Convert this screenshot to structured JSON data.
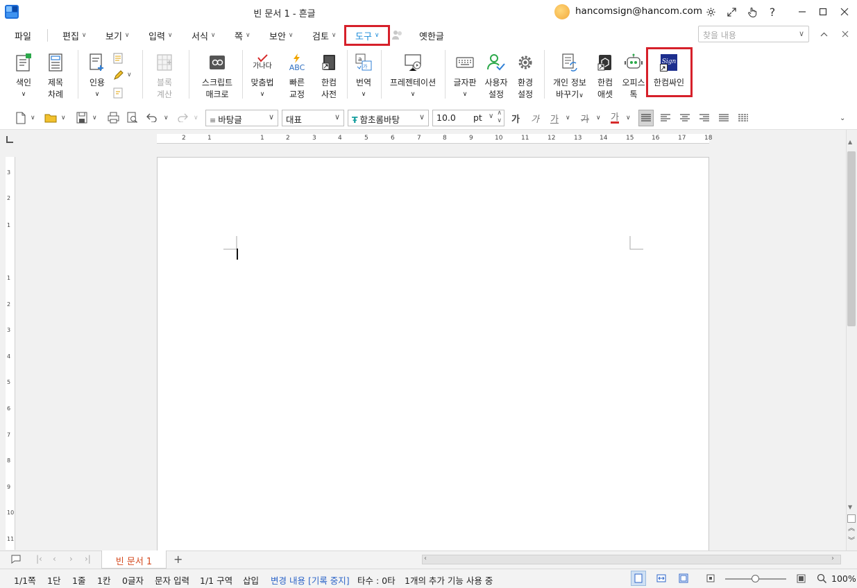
{
  "window": {
    "title": "빈 문서 1 - 흔글",
    "account": "hancomsign@hancom.com"
  },
  "menu": {
    "file": "파일",
    "items": [
      "편집",
      "보기",
      "입력",
      "서식",
      "쪽",
      "보안",
      "검토",
      "도구",
      "옛한글"
    ],
    "search_placeholder": "찾을 내용"
  },
  "ribbon": {
    "index_l1": "색인",
    "toc_l1": "제목",
    "toc_l2": "차례",
    "cite_l1": "인용",
    "block_l1": "블록",
    "block_l2": "계산",
    "script_l1": "스크립트",
    "script_l2": "매크로",
    "spell_l1": "맞춤법",
    "quick_l1": "빠른",
    "quick_l2": "교정",
    "dict_l1": "한컴",
    "dict_l2": "사전",
    "translate_l1": "번역",
    "present_l1": "프레젠테이션",
    "keyboard_l1": "글자판",
    "usercfg_l1": "사용자",
    "usercfg_l2": "설정",
    "envcfg_l1": "환경",
    "envcfg_l2": "설정",
    "privacy_l1": "개인 정보",
    "privacy_l2": "바꾸기",
    "asset_l1": "한컴",
    "asset_l2": "애셋",
    "officetalk_l1": "오피스",
    "officetalk_l2": "톡",
    "sign_l1": "한컴싸인",
    "spell_glyph": "가나다",
    "abc_glyph": "ABC",
    "sign_glyph": "Sign"
  },
  "format": {
    "style": "바탕글",
    "lang": "대표",
    "font": "함초롬바탕",
    "size": "10.0",
    "unit": "pt",
    "glyph_bold": "가",
    "glyph_italic": "가",
    "glyph_underline": "가",
    "glyph_strike": "가",
    "glyph_color": "가"
  },
  "ruler": {
    "h": [
      "2",
      "1",
      "1",
      "2",
      "3",
      "4",
      "5",
      "6",
      "7",
      "8",
      "9",
      "10",
      "11",
      "12",
      "13",
      "14",
      "15",
      "16",
      "17",
      "18"
    ],
    "v": [
      "3",
      "2",
      "1",
      "1",
      "2",
      "3",
      "4",
      "5",
      "6",
      "7",
      "8",
      "9",
      "10",
      "11"
    ]
  },
  "tabs": {
    "doc": "빈 문서 1",
    "add": "+"
  },
  "status": {
    "page": "1/1쪽",
    "col": "1단",
    "line": "1줄",
    "cell": "1칸",
    "chars": "0글자",
    "mode": "문자 입력",
    "section": "1/1 구역",
    "insert": "삽입",
    "track": "변경 내용 [기록 중지]",
    "typing": "타수 : 0타",
    "addons": "1개의 추가 기능 사용 중",
    "zoom": "100%"
  },
  "colors": {
    "highlight": "#d6202a",
    "accent": "#1a8ad8",
    "active_tab": "#d44a1f",
    "track_blue": "#2c64c8"
  }
}
